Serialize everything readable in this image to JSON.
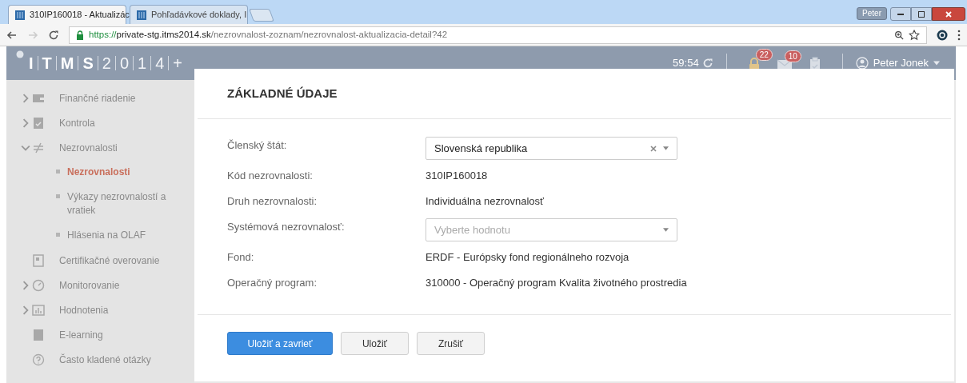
{
  "browser": {
    "tabs": [
      {
        "title": "310IP160018 - Aktualizác",
        "selected": true
      },
      {
        "title": "Pohľadávkové doklady, I",
        "selected": false
      }
    ],
    "profile": "Peter",
    "url": {
      "scheme": "https://",
      "host": "private-stg.itms2014.sk",
      "path": "/nezrovnalost-zoznam/nezrovnalost-aktualizacia-detail?42"
    }
  },
  "header": {
    "logo": [
      "I",
      "T",
      "M",
      "S",
      "2",
      "0",
      "1",
      "4",
      "+"
    ],
    "timer": "59:54",
    "notifications": [
      {
        "kind": "lock",
        "count": "22"
      },
      {
        "kind": "mail",
        "count": "10"
      },
      {
        "kind": "clipboard"
      }
    ],
    "user": "Peter Jonek"
  },
  "sidebar": {
    "items": [
      {
        "label": "Finančné riadenie",
        "kind": "wallet",
        "expanded": false,
        "selected": false
      },
      {
        "label": "Kontrola",
        "kind": "check",
        "expanded": false,
        "selected": false
      },
      {
        "label": "Nezrovnalosti",
        "kind": "notequal",
        "expanded": true,
        "selected": false,
        "children": [
          {
            "label": "Nezrovnalosti",
            "selected": true
          },
          {
            "label": "Výkazy nezrovnalostí a vratiek",
            "selected": false
          },
          {
            "label": "Hlásenia na OLAF",
            "selected": false
          }
        ]
      },
      {
        "label": "Certifikačné overovanie",
        "kind": "doc",
        "selected": false
      },
      {
        "label": "Monitorovanie",
        "kind": "gauge",
        "expanded": false,
        "selected": false
      },
      {
        "label": "Hodnotenia",
        "kind": "chart",
        "expanded": false,
        "selected": false
      },
      {
        "label": "E-learning",
        "kind": "book",
        "selected": false
      },
      {
        "label": "Často kladené otázky",
        "kind": "help",
        "selected": false
      }
    ]
  },
  "dialog": {
    "title": "ZÁKLADNÉ ÚDAJE",
    "fields": [
      {
        "kind": "select",
        "label": "Členský štát:",
        "value": "Slovenská republika",
        "clearable": true
      },
      {
        "kind": "text",
        "label": "Kód nezrovnalosti:",
        "value": "310IP160018"
      },
      {
        "kind": "text",
        "label": "Druh nezrovnalosti:",
        "value": "Individuálna nezrovnalosť"
      },
      {
        "kind": "select",
        "label": "Systémová nezrovnalosť:",
        "placeholder": "Vyberte hodnotu",
        "clearable": false
      },
      {
        "kind": "text",
        "label": "Fond:",
        "value": "ERDF - Európsky fond regionálneho rozvoja"
      },
      {
        "kind": "text",
        "label": "Operačný program:",
        "value": "310000 - Operačný program Kvalita životného prostredia"
      }
    ],
    "buttons": [
      {
        "label": "Uložiť a zavrieť",
        "primary": true
      },
      {
        "label": "Uložiť",
        "primary": false
      },
      {
        "label": "Zrušiť",
        "primary": false
      }
    ]
  }
}
